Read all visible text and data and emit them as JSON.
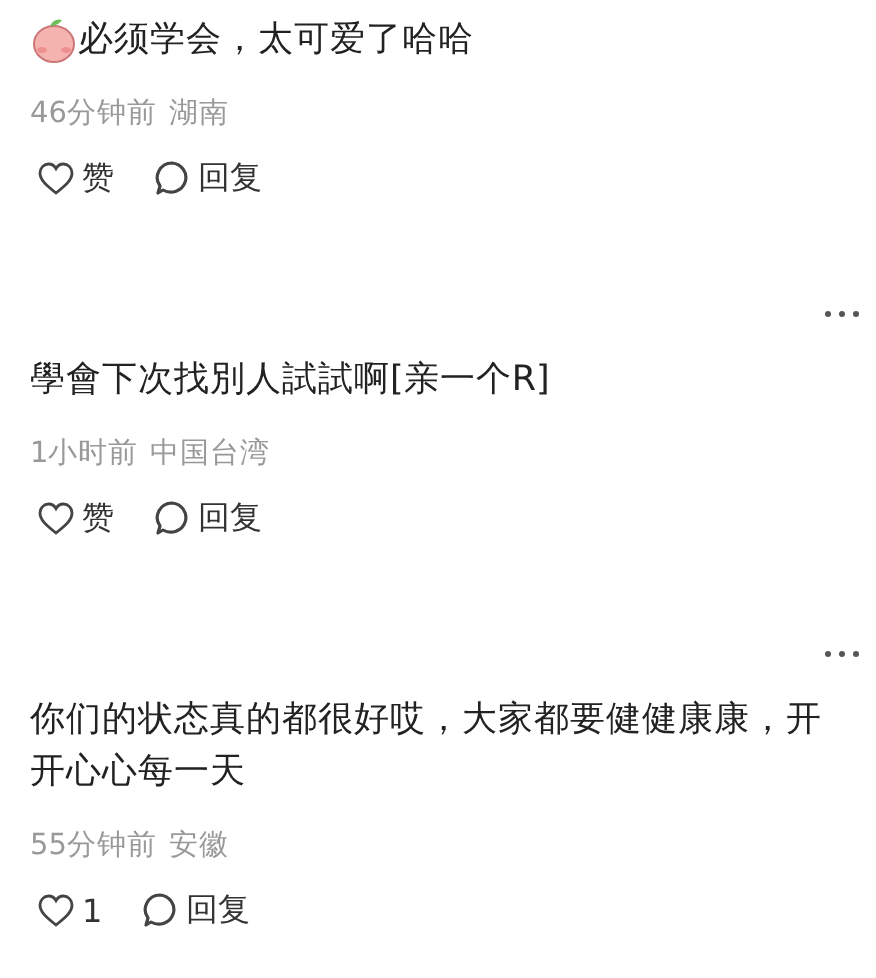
{
  "comments": [
    {
      "sticker": true,
      "menu": false,
      "text": "必须学会，太可爱了哈哈",
      "time": "46分钟前",
      "location": "湖南",
      "like": "赞",
      "reply": "回复"
    },
    {
      "sticker": false,
      "menu": true,
      "text": "學會下次找別人試試啊[亲一个R]",
      "time": "1小时前",
      "location": "中国台湾",
      "like": "赞",
      "reply": "回复"
    },
    {
      "sticker": false,
      "menu": true,
      "text": "你们的状态真的都很好哎，大家都要健健康康，开开心心每一天",
      "time": "55分钟前",
      "location": "安徽",
      "like": "1",
      "reply": "回复"
    }
  ]
}
